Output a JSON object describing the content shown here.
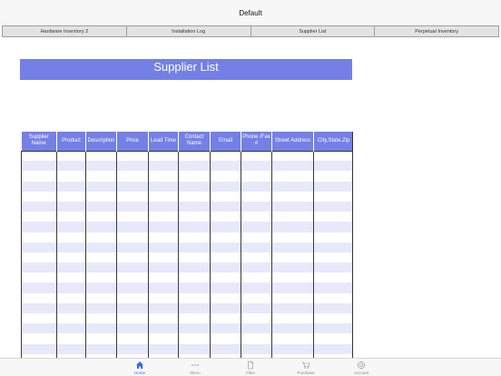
{
  "window": {
    "title": "Default"
  },
  "tabs": [
    {
      "label": "Hardware Inventory 2"
    },
    {
      "label": "Installation Log"
    },
    {
      "label": "Supplier List"
    },
    {
      "label": "Perpetual Inventory"
    }
  ],
  "sheet": {
    "title": "Supplier List",
    "columns": [
      {
        "label": "Supplier Name"
      },
      {
        "label": "Product"
      },
      {
        "label": "Description"
      },
      {
        "label": "Price"
      },
      {
        "label": "Lead Time"
      },
      {
        "label": "Contact Name"
      },
      {
        "label": "Email"
      },
      {
        "label": "Phone /Fax #"
      },
      {
        "label": "Street Address"
      },
      {
        "label": "City,State,Zip"
      }
    ]
  },
  "nav": {
    "home": {
      "label": "Home",
      "icon": "home-icon"
    },
    "menu": {
      "label": "Menu",
      "icon": "more-dots-icon"
    },
    "files": {
      "label": "Files",
      "icon": "file-icon"
    },
    "purchase": {
      "label": "Purchase",
      "icon": "cart-icon"
    },
    "account": {
      "label": "Account",
      "icon": "gear-icon"
    }
  },
  "colors": {
    "accent": "#7480e6",
    "stripe": "#e7e9fa",
    "active_nav": "#2f6fe0"
  }
}
